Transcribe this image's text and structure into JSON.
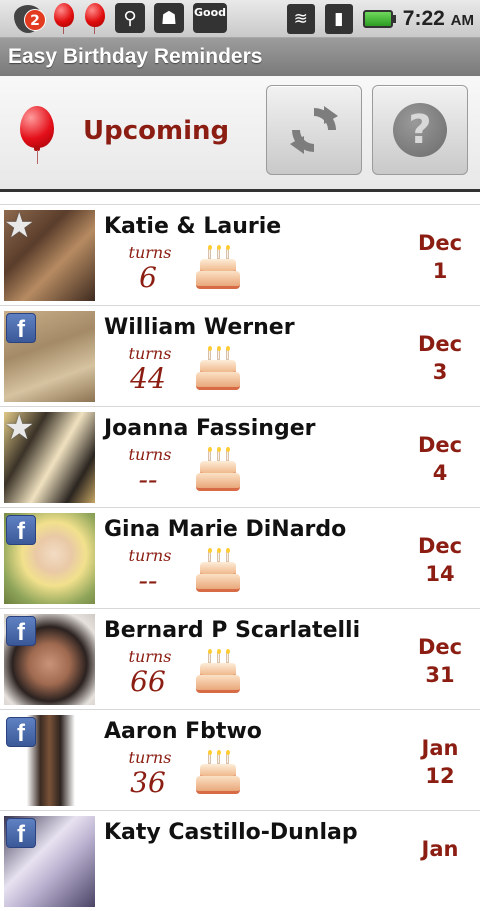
{
  "status_bar": {
    "notification_count": "2",
    "good_label": "Good",
    "time": "7:22",
    "ampm": "AM"
  },
  "app_title": "Easy Birthday Reminders",
  "header": {
    "title": "Upcoming"
  },
  "turns_label": "turns",
  "contacts": [
    {
      "name": "Katie & Laurie",
      "age": "6",
      "month": "Dec",
      "day": "1",
      "source": "star"
    },
    {
      "name": "William Werner",
      "age": "44",
      "month": "Dec",
      "day": "3",
      "source": "facebook"
    },
    {
      "name": "Joanna Fassinger",
      "age": "--",
      "month": "Dec",
      "day": "4",
      "source": "star"
    },
    {
      "name": "Gina Marie DiNardo",
      "age": "--",
      "month": "Dec",
      "day": "14",
      "source": "facebook"
    },
    {
      "name": "Bernard P Scarlatelli",
      "age": "66",
      "month": "Dec",
      "day": "31",
      "source": "facebook"
    },
    {
      "name": "Aaron Fbtwo",
      "age": "36",
      "month": "Jan",
      "day": "12",
      "source": "facebook"
    },
    {
      "name": "Katy Castillo-Dunlap",
      "age": "",
      "month": "Jan",
      "day": "",
      "source": "facebook"
    }
  ],
  "colors": {
    "accent": "#8b1d12",
    "title_bar": "#8a8a8a",
    "facebook": "#3b5998"
  }
}
